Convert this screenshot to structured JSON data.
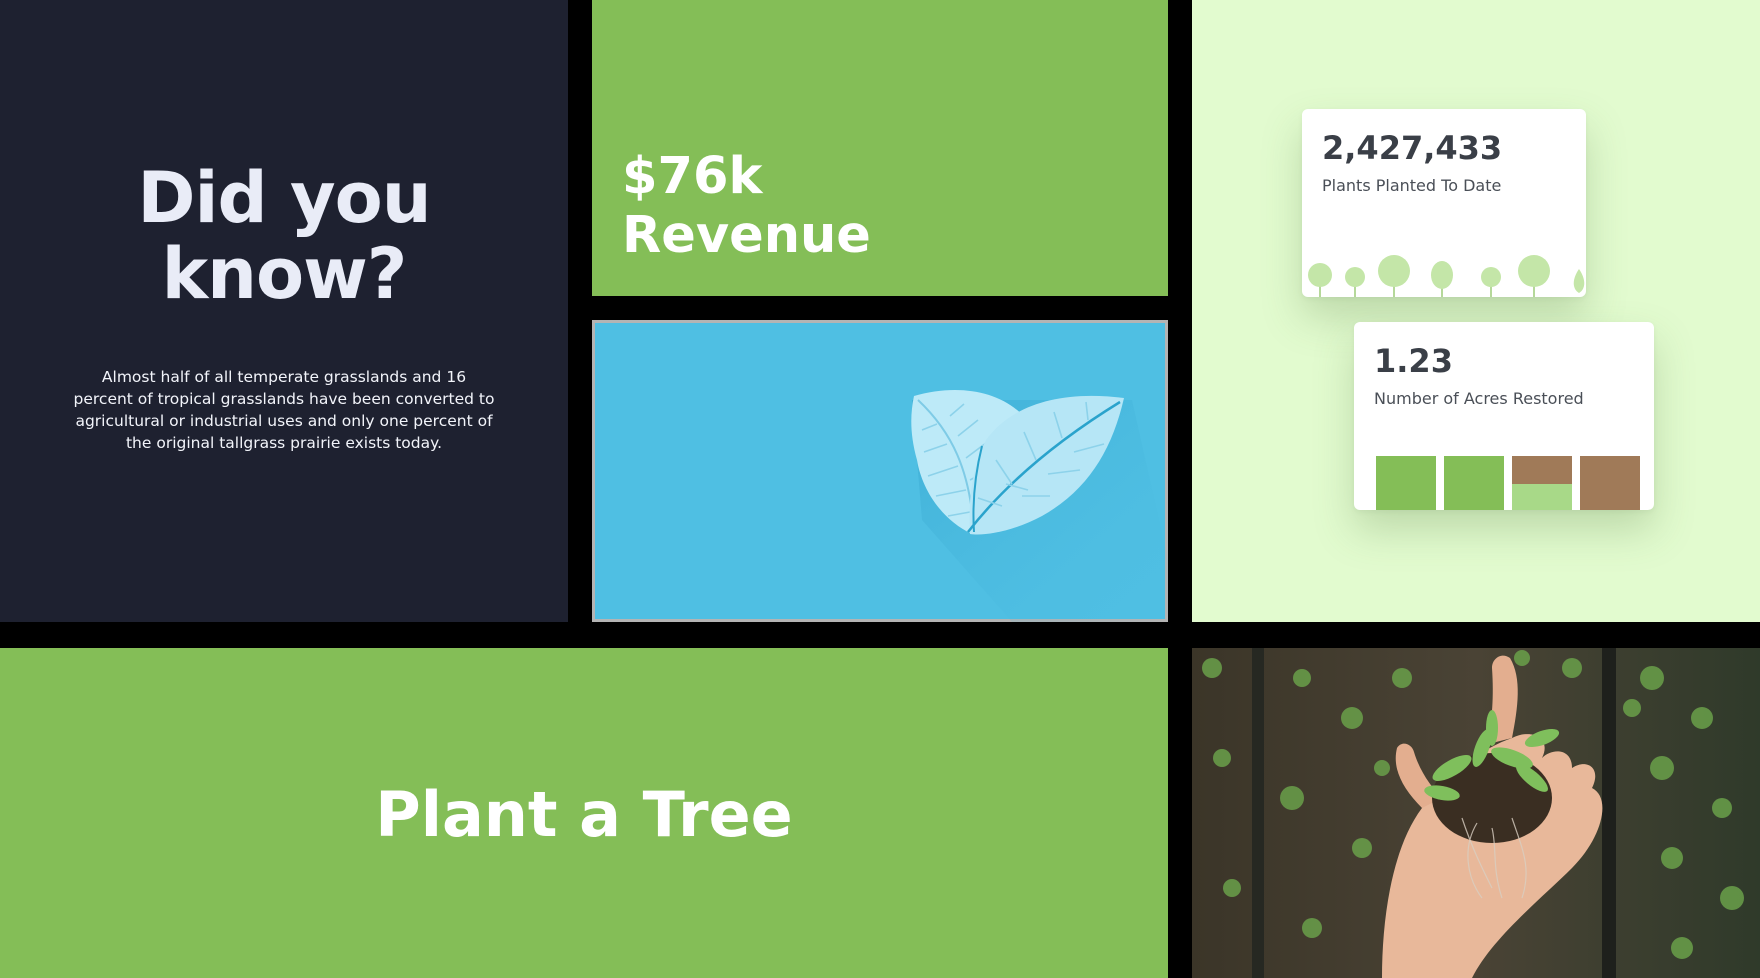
{
  "fact": {
    "heading_line1": "Did you",
    "heading_line2": "know?",
    "body": "Almost half of all temperate grasslands and 16 percent of tropical grasslands have been converted to agricultural or industrial uses and only one percent of the original tallgrass prairie exists today."
  },
  "revenue": {
    "amount": "$76k",
    "label": "Revenue"
  },
  "stats": {
    "plants": {
      "value": "2,427,433",
      "caption": "Plants Planted To Date"
    },
    "acres": {
      "value": "1.23",
      "caption": "Number of Acres Restored"
    }
  },
  "cta": {
    "text": "Plant a Tree"
  },
  "colors": {
    "brand_green": "#84be57",
    "dark_navy": "#1e2130",
    "sky_blue": "#4fbfe3",
    "mint_bg": "#e2fbcf",
    "soil_brown": "#a07a58"
  },
  "icons": {
    "leaf": "leaf-icon",
    "trees": "tree-icon",
    "photo": "seedlings-in-hand-photo"
  }
}
